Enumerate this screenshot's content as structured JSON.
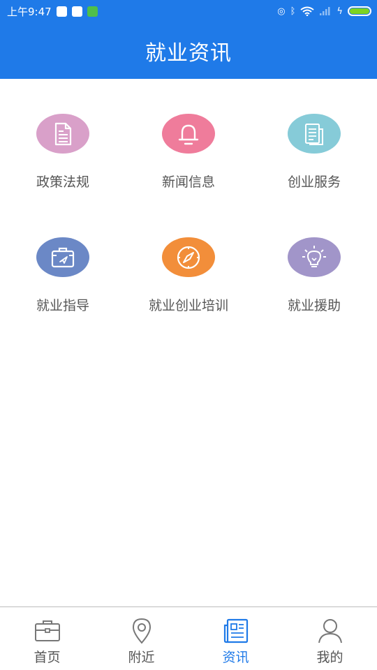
{
  "status_bar": {
    "time": "上午9:47",
    "battery_level": 1.0
  },
  "header": {
    "title": "就业资讯"
  },
  "colors": {
    "primary": "#1f7ae8",
    "policy": "#d9a0c9",
    "news": "#ef7c9b",
    "startup": "#86cbd8",
    "guidance": "#6b88c6",
    "training": "#f28e3a",
    "assistance": "#a195c9"
  },
  "menu": {
    "items": [
      {
        "label": "政策法规",
        "icon": "document-icon"
      },
      {
        "label": "新闻信息",
        "icon": "bell-icon"
      },
      {
        "label": "创业服务",
        "icon": "files-icon"
      },
      {
        "label": "就业指导",
        "icon": "briefcase-icon"
      },
      {
        "label": "就业创业培训",
        "icon": "compass-icon"
      },
      {
        "label": "就业援助",
        "icon": "lightbulb-icon"
      }
    ]
  },
  "bottom_nav": {
    "items": [
      {
        "label": "首页",
        "icon": "briefcase-icon"
      },
      {
        "label": "附近",
        "icon": "location-pin-icon"
      },
      {
        "label": "资讯",
        "icon": "newspaper-icon",
        "active": true
      },
      {
        "label": "我的",
        "icon": "user-icon"
      }
    ]
  }
}
